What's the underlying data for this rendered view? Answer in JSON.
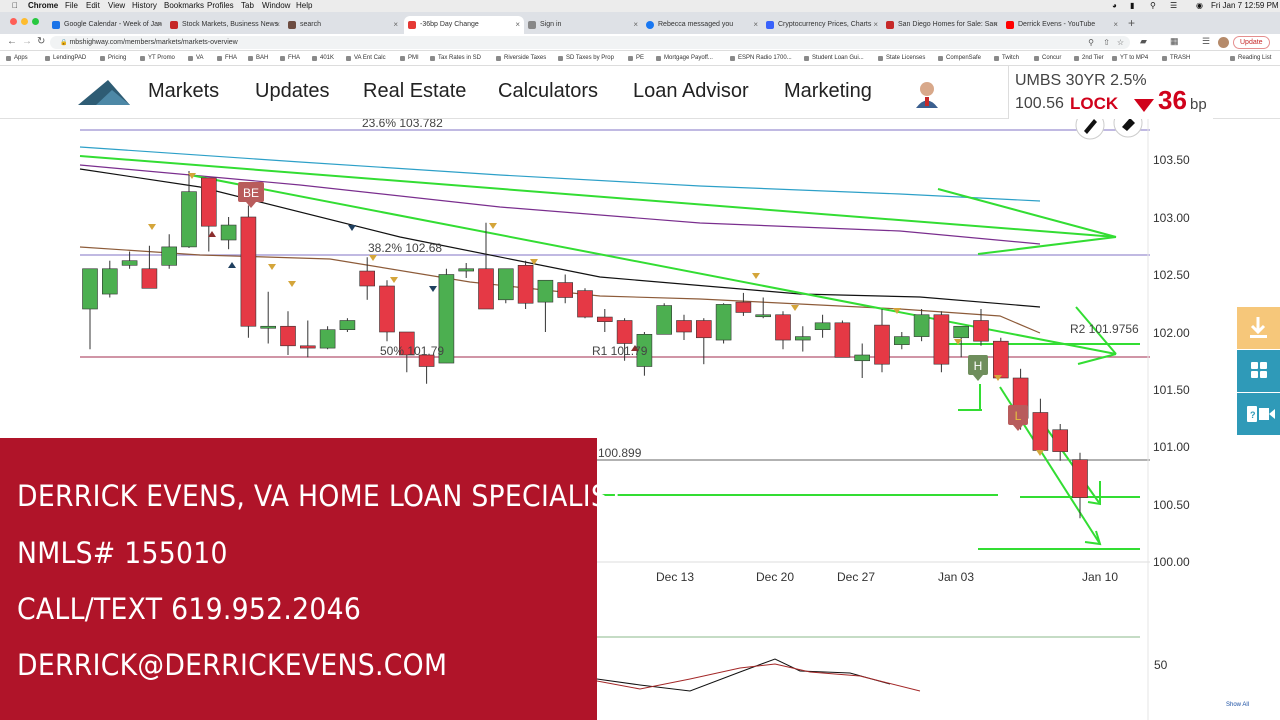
{
  "menubar": {
    "app": "Chrome",
    "items": [
      "File",
      "Edit",
      "View",
      "History",
      "Bookmarks",
      "Profiles",
      "Tab",
      "Window",
      "Help"
    ],
    "clock": "Fri Jan 7  12:59 PM"
  },
  "tabs": [
    {
      "label": "Google Calendar - Week of Jan",
      "color": "#1a73e8"
    },
    {
      "label": "Stock Markets, Business News",
      "color": "#c62828"
    },
    {
      "label": "search",
      "color": "#6d4c41"
    },
    {
      "label": "-36bp Day Change",
      "color": "#e53935"
    },
    {
      "label": "Sign in",
      "color": "#888888"
    },
    {
      "label": "Rebecca messaged you",
      "color": "#1877f2"
    },
    {
      "label": "Cryptocurrency Prices, Charts",
      "color": "#3861fb"
    },
    {
      "label": "San Diego Homes for Sale: San",
      "color": "#c62828"
    },
    {
      "label": "Derrick Evens - YouTube",
      "color": "#ff0000"
    }
  ],
  "toolbar": {
    "url": "mbshighway.com/members/markets/markets-overview",
    "update_label": "Update"
  },
  "bookmarks": [
    "Apps",
    "LendingPAD",
    "Pricing",
    "YT Promo",
    "VA",
    "FHA",
    "BAH",
    "FHA",
    "401K",
    "VA Ent Calc",
    "PMI",
    "Tax Rates in SD",
    "Riverside Taxes",
    "SD Taxes by Prop",
    "PE",
    "Mortgage Payoff...",
    "ESPN Radio 1700...",
    "Student Loan Gui...",
    "State Licenses",
    "CompenSafe",
    "Twitch",
    "Concur",
    "2nd Tier",
    "YT to MP4",
    "TRASH"
  ],
  "reading_list": "Reading List",
  "site_nav": {
    "items": [
      "Markets",
      "Updates",
      "Real Estate",
      "Calculators",
      "Loan Advisor",
      "Marketing"
    ]
  },
  "rate_box": {
    "instrument": "UMBS 30YR 2.5%",
    "price": "100.56",
    "action": "LOCK",
    "change": "36",
    "unit": "bp",
    "change_color": "#d0021b"
  },
  "chart_data": {
    "type": "candlestick",
    "y_ticks": [
      "103.50",
      "103.00",
      "102.50",
      "102.00",
      "101.50",
      "101.00",
      "100.50",
      "100.00"
    ],
    "ylim": [
      100.0,
      103.5
    ],
    "x_ticks": [
      "Dec 13",
      "Dec 20",
      "Dec 27",
      "Jan 03",
      "Jan 10"
    ],
    "levels": [
      {
        "label": "23.6% 103.782",
        "value": 103.782
      },
      {
        "label": "38.2% 102.68",
        "value": 102.68
      },
      {
        "label": "50% 101.79",
        "value": 101.79
      },
      {
        "label": "R1 101.79",
        "value": 101.79
      },
      {
        "label": "R2 101.9756",
        "value": 101.9756
      },
      {
        "label": "100.899",
        "value": 100.899
      }
    ],
    "candle_labels": [
      "BE",
      "H",
      "L"
    ],
    "candles": [
      {
        "o": 102.2,
        "h": 102.55,
        "l": 101.85,
        "c": 102.55
      },
      {
        "o": 102.33,
        "h": 102.62,
        "l": 102.3,
        "c": 102.55
      },
      {
        "o": 102.58,
        "h": 102.7,
        "l": 102.55,
        "c": 102.62
      },
      {
        "o": 102.55,
        "h": 102.75,
        "l": 102.4,
        "c": 102.38
      },
      {
        "o": 102.58,
        "h": 102.85,
        "l": 102.55,
        "c": 102.74
      },
      {
        "o": 102.74,
        "h": 103.4,
        "l": 102.73,
        "c": 103.22
      },
      {
        "o": 103.34,
        "h": 103.34,
        "l": 102.7,
        "c": 102.92
      },
      {
        "o": 102.8,
        "h": 103.0,
        "l": 102.72,
        "c": 102.93
      },
      {
        "o": 103.0,
        "h": 103.1,
        "l": 101.95,
        "c": 102.05
      },
      {
        "o": 102.05,
        "h": 102.35,
        "l": 101.9,
        "c": 102.05
      },
      {
        "o": 102.05,
        "h": 102.18,
        "l": 101.8,
        "c": 101.88
      },
      {
        "o": 101.88,
        "h": 102.1,
        "l": 101.78,
        "c": 101.86
      },
      {
        "o": 101.86,
        "h": 102.05,
        "l": 101.85,
        "c": 102.02
      },
      {
        "o": 102.02,
        "h": 102.12,
        "l": 102.0,
        "c": 102.1
      },
      {
        "o": 102.53,
        "h": 102.65,
        "l": 102.28,
        "c": 102.4
      },
      {
        "o": 102.4,
        "h": 102.45,
        "l": 101.92,
        "c": 102.0
      },
      {
        "o": 102.0,
        "h": 102.0,
        "l": 101.65,
        "c": 101.8
      },
      {
        "o": 101.8,
        "h": 101.8,
        "l": 101.55,
        "c": 101.7
      },
      {
        "o": 101.73,
        "h": 102.55,
        "l": 101.73,
        "c": 102.5
      },
      {
        "o": 102.53,
        "h": 102.6,
        "l": 102.47,
        "c": 102.55
      },
      {
        "o": 102.55,
        "h": 102.95,
        "l": 102.2,
        "c": 102.2
      },
      {
        "o": 102.28,
        "h": 102.55,
        "l": 102.25,
        "c": 102.55
      },
      {
        "o": 102.58,
        "h": 102.62,
        "l": 102.2,
        "c": 102.25
      },
      {
        "o": 102.26,
        "h": 102.45,
        "l": 102.0,
        "c": 102.45
      },
      {
        "o": 102.43,
        "h": 102.5,
        "l": 102.25,
        "c": 102.3
      },
      {
        "o": 102.36,
        "h": 102.38,
        "l": 102.12,
        "c": 102.13
      },
      {
        "o": 102.13,
        "h": 102.2,
        "l": 102.0,
        "c": 102.09
      },
      {
        "o": 102.1,
        "h": 102.12,
        "l": 101.75,
        "c": 101.9
      },
      {
        "o": 101.7,
        "h": 102.0,
        "l": 101.62,
        "c": 101.98
      },
      {
        "o": 101.98,
        "h": 102.25,
        "l": 101.98,
        "c": 102.23
      },
      {
        "o": 102.1,
        "h": 102.15,
        "l": 101.93,
        "c": 102.0
      },
      {
        "o": 102.1,
        "h": 102.12,
        "l": 101.72,
        "c": 101.95
      },
      {
        "o": 101.93,
        "h": 102.25,
        "l": 101.9,
        "c": 102.24
      },
      {
        "o": 102.26,
        "h": 102.34,
        "l": 102.14,
        "c": 102.17
      },
      {
        "o": 102.15,
        "h": 102.3,
        "l": 102.12,
        "c": 102.15
      },
      {
        "o": 102.15,
        "h": 102.18,
        "l": 101.85,
        "c": 101.93
      },
      {
        "o": 101.93,
        "h": 102.05,
        "l": 101.83,
        "c": 101.96
      },
      {
        "o": 102.02,
        "h": 102.15,
        "l": 101.95,
        "c": 102.08
      },
      {
        "o": 102.08,
        "h": 102.1,
        "l": 101.78,
        "c": 101.78
      },
      {
        "o": 101.75,
        "h": 101.9,
        "l": 101.6,
        "c": 101.8
      },
      {
        "o": 102.06,
        "h": 102.2,
        "l": 101.65,
        "c": 101.72
      },
      {
        "o": 101.89,
        "h": 102.0,
        "l": 101.85,
        "c": 101.96
      },
      {
        "o": 101.96,
        "h": 102.2,
        "l": 101.92,
        "c": 102.15
      },
      {
        "o": 102.15,
        "h": 102.18,
        "l": 101.65,
        "c": 101.72
      },
      {
        "o": 101.95,
        "h": 102.05,
        "l": 101.78,
        "c": 102.05
      },
      {
        "o": 102.1,
        "h": 102.2,
        "l": 101.88,
        "c": 101.92
      },
      {
        "o": 101.92,
        "h": 101.95,
        "l": 101.6,
        "c": 101.6
      },
      {
        "o": 101.6,
        "h": 101.68,
        "l": 101.15,
        "c": 101.25
      },
      {
        "o": 101.3,
        "h": 101.42,
        "l": 100.97,
        "c": 100.97
      },
      {
        "o": 101.15,
        "h": 101.2,
        "l": 100.88,
        "c": 100.96
      },
      {
        "o": 100.89,
        "h": 100.95,
        "l": 100.38,
        "c": 100.56
      }
    ],
    "up_color": "#4caf50",
    "down_color": "#e53945"
  },
  "lower_pane": {
    "tick": "50"
  },
  "overlay": {
    "line1": "DERRICK EVENS, VA HOME LOAN SPECIALIST",
    "line2": "NMLS# 155010",
    "line3": "CALL/TEXT 619.952.2046",
    "line4": "DERRICK@DERRICKEVENS.COM",
    "bg_color": "#b01429"
  },
  "side_tools": [
    "download-icon",
    "grid-icon",
    "video-icon"
  ],
  "show_all": "Show All"
}
